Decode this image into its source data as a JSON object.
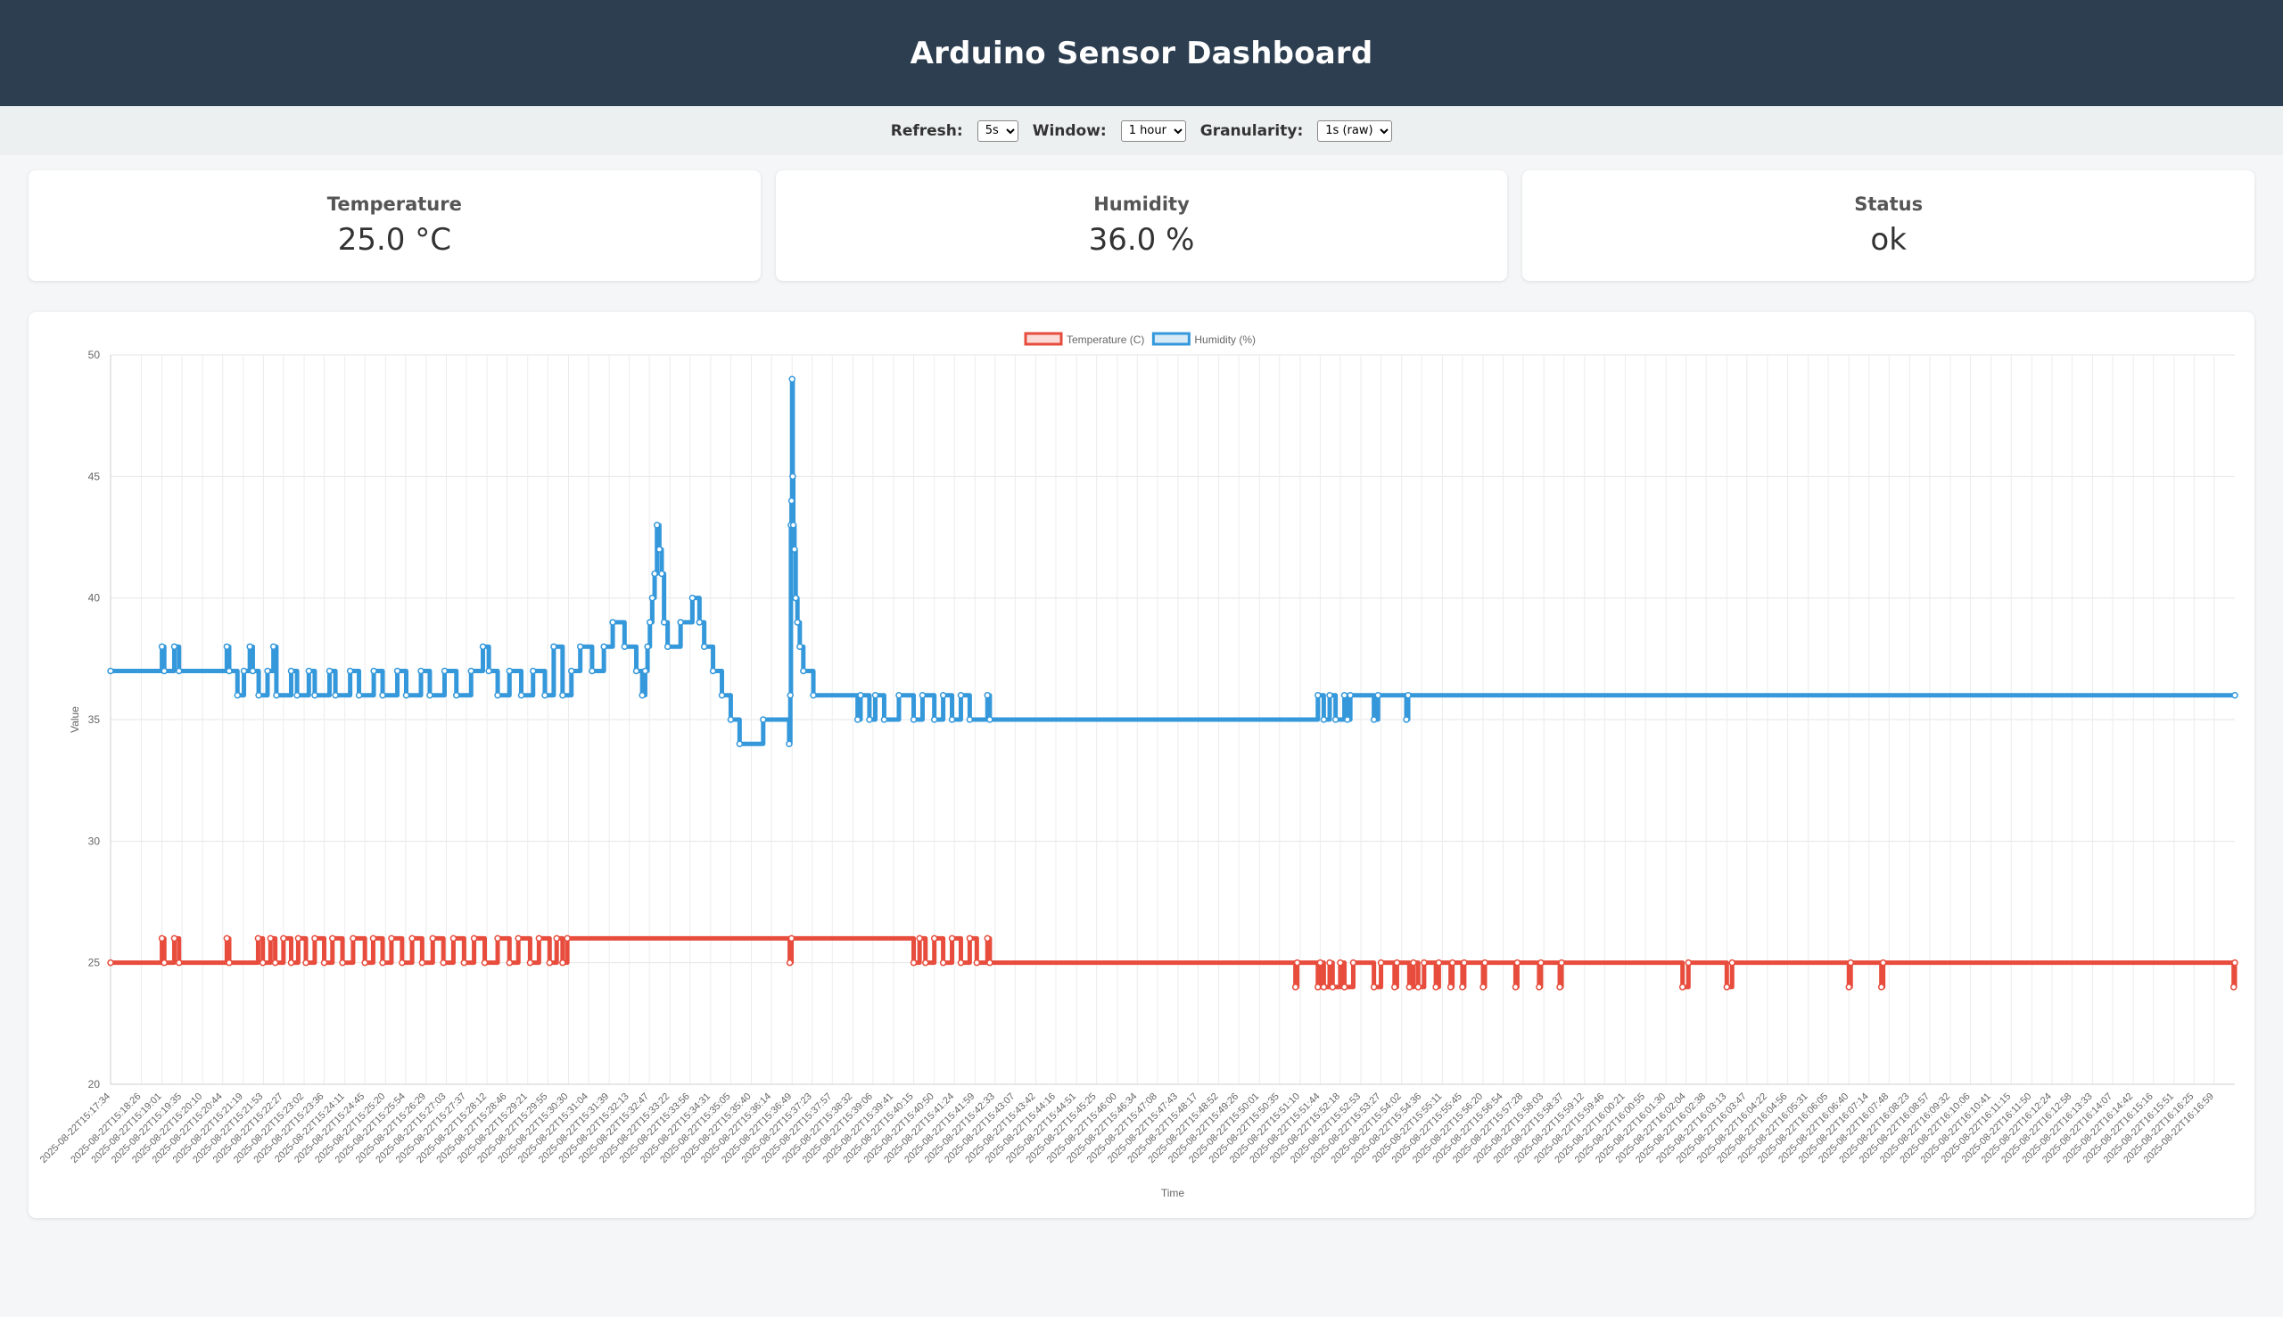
{
  "header": {
    "title": "Arduino Sensor Dashboard"
  },
  "controls": {
    "refresh_label": "Refresh:",
    "refresh_value": "5s",
    "window_label": "Window:",
    "window_value": "1 hour",
    "granularity_label": "Granularity:",
    "granularity_value": "1s (raw)"
  },
  "cards": {
    "temperature": {
      "label": "Temperature",
      "value": "25.0 °C"
    },
    "humidity": {
      "label": "Humidity",
      "value": "36.0 %"
    },
    "status": {
      "label": "Status",
      "value": "ok"
    }
  },
  "colors": {
    "header_bg": "#2c3e50",
    "temperature_line": "#e74c3c",
    "humidity_line": "#3498db"
  },
  "chart_data": {
    "type": "line",
    "ylabel": "Value",
    "xlabel": "Time",
    "ylim": [
      20,
      50
    ],
    "yticks": [
      20,
      25,
      30,
      35,
      40,
      45,
      50
    ],
    "grid": true,
    "legend_position": "top-center",
    "x_ticks": [
      "2025-08-22T15:17:34",
      "2025-08-22T15:18:26",
      "2025-08-22T15:19:01",
      "2025-08-22T15:19:35",
      "2025-08-22T15:20:10",
      "2025-08-22T15:20:44",
      "2025-08-22T15:21:19",
      "2025-08-22T15:21:53",
      "2025-08-22T15:22:27",
      "2025-08-22T15:23:02",
      "2025-08-22T15:23:36",
      "2025-08-22T15:24:11",
      "2025-08-22T15:24:45",
      "2025-08-22T15:25:20",
      "2025-08-22T15:25:54",
      "2025-08-22T15:26:29",
      "2025-08-22T15:27:03",
      "2025-08-22T15:27:37",
      "2025-08-22T15:28:12",
      "2025-08-22T15:28:46",
      "2025-08-22T15:29:21",
      "2025-08-22T15:29:55",
      "2025-08-22T15:30:30",
      "2025-08-22T15:31:04",
      "2025-08-22T15:31:39",
      "2025-08-22T15:32:13",
      "2025-08-22T15:32:47",
      "2025-08-22T15:33:22",
      "2025-08-22T15:33:56",
      "2025-08-22T15:34:31",
      "2025-08-22T15:35:05",
      "2025-08-22T15:35:40",
      "2025-08-22T15:36:14",
      "2025-08-22T15:36:49",
      "2025-08-22T15:37:23",
      "2025-08-22T15:37:57",
      "2025-08-22T15:38:32",
      "2025-08-22T15:39:06",
      "2025-08-22T15:39:41",
      "2025-08-22T15:40:15",
      "2025-08-22T15:40:50",
      "2025-08-22T15:41:24",
      "2025-08-22T15:41:59",
      "2025-08-22T15:42:33",
      "2025-08-22T15:43:07",
      "2025-08-22T15:43:42",
      "2025-08-22T15:44:16",
      "2025-08-22T15:44:51",
      "2025-08-22T15:45:25",
      "2025-08-22T15:46:00",
      "2025-08-22T15:46:34",
      "2025-08-22T15:47:08",
      "2025-08-22T15:47:43",
      "2025-08-22T15:48:17",
      "2025-08-22T15:48:52",
      "2025-08-22T15:49:26",
      "2025-08-22T15:50:01",
      "2025-08-22T15:50:35",
      "2025-08-22T15:51:10",
      "2025-08-22T15:51:44",
      "2025-08-22T15:52:18",
      "2025-08-22T15:52:53",
      "2025-08-22T15:53:27",
      "2025-08-22T15:54:02",
      "2025-08-22T15:54:36",
      "2025-08-22T15:55:11",
      "2025-08-22T15:55:45",
      "2025-08-22T15:56:20",
      "2025-08-22T15:56:54",
      "2025-08-22T15:57:28",
      "2025-08-22T15:58:03",
      "2025-08-22T15:58:37",
      "2025-08-22T15:59:12",
      "2025-08-22T15:59:46",
      "2025-08-22T16:00:21",
      "2025-08-22T16:00:55",
      "2025-08-22T16:01:30",
      "2025-08-22T16:02:04",
      "2025-08-22T16:02:38",
      "2025-08-22T16:03:13",
      "2025-08-22T16:03:47",
      "2025-08-22T16:04:22",
      "2025-08-22T16:04:56",
      "2025-08-22T16:05:31",
      "2025-08-22T16:06:05",
      "2025-08-22T16:06:40",
      "2025-08-22T16:07:14",
      "2025-08-22T16:07:48",
      "2025-08-22T16:08:23",
      "2025-08-22T16:08:57",
      "2025-08-22T16:09:32",
      "2025-08-22T16:10:06",
      "2025-08-22T16:10:41",
      "2025-08-22T16:11:15",
      "2025-08-22T16:11:50",
      "2025-08-22T16:12:24",
      "2025-08-22T16:12:58",
      "2025-08-22T16:13:33",
      "2025-08-22T16:14:07",
      "2025-08-22T16:14:42",
      "2025-08-22T16:15:16",
      "2025-08-22T16:15:51",
      "2025-08-22T16:16:25",
      "2025-08-22T16:16:59"
    ],
    "x_start": "2025-08-22T15:17:34",
    "x_end": "2025-08-22T16:17:34",
    "series": [
      {
        "name": "Temperature (C)",
        "color": "#e74c3c",
        "steps": [
          [
            "2025-08-22T15:17:34",
            25
          ],
          [
            "2025-08-22T15:19:01",
            26
          ],
          [
            "2025-08-22T15:19:05",
            25
          ],
          [
            "2025-08-22T15:19:22",
            26
          ],
          [
            "2025-08-22T15:19:30",
            25
          ],
          [
            "2025-08-22T15:20:51",
            26
          ],
          [
            "2025-08-22T15:20:55",
            25
          ],
          [
            "2025-08-22T15:21:44",
            26
          ],
          [
            "2025-08-22T15:21:52",
            25
          ],
          [
            "2025-08-22T15:22:05",
            26
          ],
          [
            "2025-08-22T15:22:13",
            25
          ],
          [
            "2025-08-22T15:22:27",
            26
          ],
          [
            "2025-08-22T15:22:40",
            25
          ],
          [
            "2025-08-22T15:22:52",
            26
          ],
          [
            "2025-08-22T15:23:05",
            25
          ],
          [
            "2025-08-22T15:23:20",
            26
          ],
          [
            "2025-08-22T15:23:36",
            25
          ],
          [
            "2025-08-22T15:23:50",
            26
          ],
          [
            "2025-08-22T15:24:07",
            25
          ],
          [
            "2025-08-22T15:24:25",
            26
          ],
          [
            "2025-08-22T15:24:45",
            25
          ],
          [
            "2025-08-22T15:24:59",
            26
          ],
          [
            "2025-08-22T15:25:15",
            25
          ],
          [
            "2025-08-22T15:25:30",
            26
          ],
          [
            "2025-08-22T15:25:48",
            25
          ],
          [
            "2025-08-22T15:26:05",
            26
          ],
          [
            "2025-08-22T15:26:22",
            25
          ],
          [
            "2025-08-22T15:26:40",
            26
          ],
          [
            "2025-08-22T15:26:58",
            25
          ],
          [
            "2025-08-22T15:27:15",
            26
          ],
          [
            "2025-08-22T15:27:33",
            25
          ],
          [
            "2025-08-22T15:27:50",
            26
          ],
          [
            "2025-08-22T15:28:08",
            25
          ],
          [
            "2025-08-22T15:28:30",
            26
          ],
          [
            "2025-08-22T15:28:50",
            25
          ],
          [
            "2025-08-22T15:29:05",
            26
          ],
          [
            "2025-08-22T15:29:25",
            25
          ],
          [
            "2025-08-22T15:29:40",
            26
          ],
          [
            "2025-08-22T15:29:58",
            25
          ],
          [
            "2025-08-22T15:30:10",
            26
          ],
          [
            "2025-08-22T15:30:20",
            25
          ],
          [
            "2025-08-22T15:30:28",
            26
          ],
          [
            "2025-08-22T15:36:45",
            25
          ],
          [
            "2025-08-22T15:36:48",
            26
          ],
          [
            "2025-08-22T15:40:15",
            25
          ],
          [
            "2025-08-22T15:40:25",
            26
          ],
          [
            "2025-08-22T15:40:35",
            25
          ],
          [
            "2025-08-22T15:40:50",
            26
          ],
          [
            "2025-08-22T15:41:05",
            25
          ],
          [
            "2025-08-22T15:41:20",
            26
          ],
          [
            "2025-08-22T15:41:35",
            25
          ],
          [
            "2025-08-22T15:41:50",
            26
          ],
          [
            "2025-08-22T15:42:02",
            25
          ],
          [
            "2025-08-22T15:42:20",
            26
          ],
          [
            "2025-08-22T15:42:24",
            25
          ],
          [
            "2025-08-22T15:51:02",
            24
          ],
          [
            "2025-08-22T15:51:05",
            25
          ],
          [
            "2025-08-22T15:51:40",
            24
          ],
          [
            "2025-08-22T15:51:44",
            25
          ],
          [
            "2025-08-22T15:51:50",
            24
          ],
          [
            "2025-08-22T15:52:00",
            25
          ],
          [
            "2025-08-22T15:52:05",
            24
          ],
          [
            "2025-08-22T15:52:18",
            25
          ],
          [
            "2025-08-22T15:52:25",
            24
          ],
          [
            "2025-08-22T15:52:40",
            25
          ],
          [
            "2025-08-22T15:53:15",
            24
          ],
          [
            "2025-08-22T15:53:27",
            25
          ],
          [
            "2025-08-22T15:53:50",
            24
          ],
          [
            "2025-08-22T15:53:54",
            25
          ],
          [
            "2025-08-22T15:54:15",
            24
          ],
          [
            "2025-08-22T15:54:22",
            25
          ],
          [
            "2025-08-22T15:54:30",
            24
          ],
          [
            "2025-08-22T15:54:40",
            25
          ],
          [
            "2025-08-22T15:55:00",
            24
          ],
          [
            "2025-08-22T15:55:05",
            25
          ],
          [
            "2025-08-22T15:55:25",
            24
          ],
          [
            "2025-08-22T15:55:28",
            25
          ],
          [
            "2025-08-22T15:55:45",
            24
          ],
          [
            "2025-08-22T15:55:48",
            25
          ],
          [
            "2025-08-22T15:56:20",
            24
          ],
          [
            "2025-08-22T15:56:23",
            25
          ],
          [
            "2025-08-22T15:57:15",
            24
          ],
          [
            "2025-08-22T15:57:18",
            25
          ],
          [
            "2025-08-22T15:57:55",
            24
          ],
          [
            "2025-08-22T15:57:58",
            25
          ],
          [
            "2025-08-22T15:58:30",
            24
          ],
          [
            "2025-08-22T15:58:33",
            25
          ],
          [
            "2025-08-22T16:01:58",
            24
          ],
          [
            "2025-08-22T16:02:08",
            25
          ],
          [
            "2025-08-22T16:03:13",
            24
          ],
          [
            "2025-08-22T16:03:22",
            25
          ],
          [
            "2025-08-22T16:06:40",
            24
          ],
          [
            "2025-08-22T16:06:43",
            25
          ],
          [
            "2025-08-22T16:07:35",
            24
          ],
          [
            "2025-08-22T16:07:38",
            25
          ],
          [
            "2025-08-22T16:17:32",
            24
          ],
          [
            "2025-08-22T16:17:34",
            25
          ]
        ]
      },
      {
        "name": "Humidity (%)",
        "color": "#3498db",
        "steps": [
          [
            "2025-08-22T15:17:34",
            37
          ],
          [
            "2025-08-22T15:19:01",
            38
          ],
          [
            "2025-08-22T15:19:05",
            37
          ],
          [
            "2025-08-22T15:19:22",
            38
          ],
          [
            "2025-08-22T15:19:30",
            37
          ],
          [
            "2025-08-22T15:20:51",
            38
          ],
          [
            "2025-08-22T15:20:55",
            37
          ],
          [
            "2025-08-22T15:21:09",
            36
          ],
          [
            "2025-08-22T15:21:20",
            37
          ],
          [
            "2025-08-22T15:21:30",
            38
          ],
          [
            "2025-08-22T15:21:35",
            37
          ],
          [
            "2025-08-22T15:21:45",
            36
          ],
          [
            "2025-08-22T15:22:00",
            37
          ],
          [
            "2025-08-22T15:22:10",
            38
          ],
          [
            "2025-08-22T15:22:15",
            36
          ],
          [
            "2025-08-22T15:22:40",
            37
          ],
          [
            "2025-08-22T15:22:50",
            36
          ],
          [
            "2025-08-22T15:23:10",
            37
          ],
          [
            "2025-08-22T15:23:20",
            36
          ],
          [
            "2025-08-22T15:23:45",
            37
          ],
          [
            "2025-08-22T15:23:55",
            36
          ],
          [
            "2025-08-22T15:24:20",
            37
          ],
          [
            "2025-08-22T15:24:35",
            36
          ],
          [
            "2025-08-22T15:25:00",
            37
          ],
          [
            "2025-08-22T15:25:15",
            36
          ],
          [
            "2025-08-22T15:25:40",
            37
          ],
          [
            "2025-08-22T15:25:55",
            36
          ],
          [
            "2025-08-22T15:26:20",
            37
          ],
          [
            "2025-08-22T15:26:35",
            36
          ],
          [
            "2025-08-22T15:27:00",
            37
          ],
          [
            "2025-08-22T15:27:20",
            36
          ],
          [
            "2025-08-22T15:27:45",
            37
          ],
          [
            "2025-08-22T15:28:05",
            38
          ],
          [
            "2025-08-22T15:28:15",
            37
          ],
          [
            "2025-08-22T15:28:30",
            36
          ],
          [
            "2025-08-22T15:28:50",
            37
          ],
          [
            "2025-08-22T15:29:10",
            36
          ],
          [
            "2025-08-22T15:29:30",
            37
          ],
          [
            "2025-08-22T15:29:50",
            36
          ],
          [
            "2025-08-22T15:30:05",
            38
          ],
          [
            "2025-08-22T15:30:20",
            36
          ],
          [
            "2025-08-22T15:30:35",
            37
          ],
          [
            "2025-08-22T15:30:50",
            38
          ],
          [
            "2025-08-22T15:31:10",
            37
          ],
          [
            "2025-08-22T15:31:30",
            38
          ],
          [
            "2025-08-22T15:31:45",
            39
          ],
          [
            "2025-08-22T15:32:05",
            38
          ],
          [
            "2025-08-22T15:32:25",
            37
          ],
          [
            "2025-08-22T15:32:35",
            36
          ],
          [
            "2025-08-22T15:32:40",
            37
          ],
          [
            "2025-08-22T15:32:44",
            38
          ],
          [
            "2025-08-22T15:32:48",
            39
          ],
          [
            "2025-08-22T15:32:52",
            40
          ],
          [
            "2025-08-22T15:32:56",
            41
          ],
          [
            "2025-08-22T15:33:00",
            43
          ],
          [
            "2025-08-22T15:33:04",
            42
          ],
          [
            "2025-08-22T15:33:08",
            41
          ],
          [
            "2025-08-22T15:33:12",
            39
          ],
          [
            "2025-08-22T15:33:18",
            38
          ],
          [
            "2025-08-22T15:33:40",
            39
          ],
          [
            "2025-08-22T15:34:00",
            40
          ],
          [
            "2025-08-22T15:34:12",
            39
          ],
          [
            "2025-08-22T15:34:20",
            38
          ],
          [
            "2025-08-22T15:34:35",
            37
          ],
          [
            "2025-08-22T15:34:50",
            36
          ],
          [
            "2025-08-22T15:35:05",
            35
          ],
          [
            "2025-08-22T15:35:20",
            34
          ],
          [
            "2025-08-22T15:36:00",
            35
          ],
          [
            "2025-08-22T15:36:44",
            34
          ],
          [
            "2025-08-22T15:36:46",
            36
          ],
          [
            "2025-08-22T15:36:47",
            43
          ],
          [
            "2025-08-22T15:36:48",
            44
          ],
          [
            "2025-08-22T15:36:49",
            49
          ],
          [
            "2025-08-22T15:36:50",
            45
          ],
          [
            "2025-08-22T15:36:51",
            43
          ],
          [
            "2025-08-22T15:36:53",
            42
          ],
          [
            "2025-08-22T15:36:55",
            40
          ],
          [
            "2025-08-22T15:36:58",
            39
          ],
          [
            "2025-08-22T15:37:02",
            38
          ],
          [
            "2025-08-22T15:37:08",
            37
          ],
          [
            "2025-08-22T15:37:25",
            36
          ],
          [
            "2025-08-22T15:38:40",
            35
          ],
          [
            "2025-08-22T15:38:45",
            36
          ],
          [
            "2025-08-22T15:39:00",
            35
          ],
          [
            "2025-08-22T15:39:10",
            36
          ],
          [
            "2025-08-22T15:39:25",
            35
          ],
          [
            "2025-08-22T15:39:50",
            36
          ],
          [
            "2025-08-22T15:40:15",
            35
          ],
          [
            "2025-08-22T15:40:30",
            36
          ],
          [
            "2025-08-22T15:40:50",
            35
          ],
          [
            "2025-08-22T15:41:05",
            36
          ],
          [
            "2025-08-22T15:41:20",
            35
          ],
          [
            "2025-08-22T15:41:35",
            36
          ],
          [
            "2025-08-22T15:41:50",
            35
          ],
          [
            "2025-08-22T15:42:20",
            36
          ],
          [
            "2025-08-22T15:42:24",
            35
          ],
          [
            "2025-08-22T15:51:40",
            36
          ],
          [
            "2025-08-22T15:51:50",
            35
          ],
          [
            "2025-08-22T15:52:00",
            36
          ],
          [
            "2025-08-22T15:52:10",
            35
          ],
          [
            "2025-08-22T15:52:25",
            36
          ],
          [
            "2025-08-22T15:52:30",
            35
          ],
          [
            "2025-08-22T15:52:35",
            36
          ],
          [
            "2025-08-22T15:53:15",
            35
          ],
          [
            "2025-08-22T15:53:22",
            36
          ],
          [
            "2025-08-22T15:54:10",
            35
          ],
          [
            "2025-08-22T15:54:13",
            36
          ],
          [
            "2025-08-22T16:17:34",
            36
          ]
        ]
      }
    ]
  }
}
